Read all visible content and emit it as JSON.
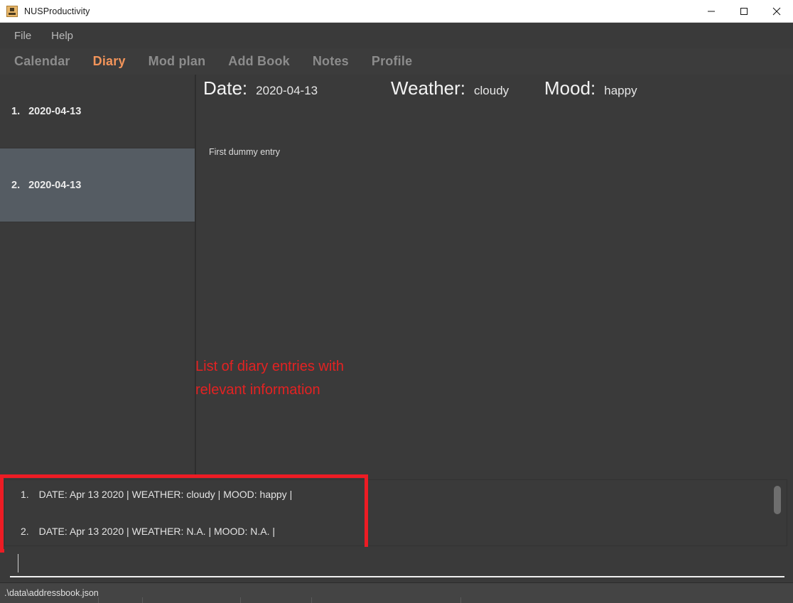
{
  "window": {
    "title": "NUSProductivity",
    "icon": "app-icon",
    "controls": {
      "minimize": "—",
      "maximize": "□",
      "close": "✕"
    }
  },
  "menubar": {
    "items": [
      {
        "label": "File"
      },
      {
        "label": "Help"
      }
    ]
  },
  "tabs": [
    {
      "label": "Calendar",
      "active": false
    },
    {
      "label": "Diary",
      "active": true
    },
    {
      "label": "Mod plan",
      "active": false
    },
    {
      "label": "Add Book",
      "active": false
    },
    {
      "label": "Notes",
      "active": false
    },
    {
      "label": "Profile",
      "active": false
    }
  ],
  "sidebar": {
    "entries": [
      {
        "index": "1.",
        "date": "2020-04-13",
        "selected": false
      },
      {
        "index": "2.",
        "date": "2020-04-13",
        "selected": true
      }
    ]
  },
  "detail": {
    "date_label": "Date:",
    "date_value": "2020-04-13",
    "weather_label": "Weather:",
    "weather_value": "cloudy",
    "mood_label": "Mood:",
    "mood_value": "happy",
    "entry_text": "First dummy entry"
  },
  "annotation": {
    "text": "List of diary entries with\nrelevant information",
    "color": "#e32222"
  },
  "result_box": {
    "lines": [
      {
        "index": "1.",
        "text": "DATE: Apr 13 2020 | WEATHER: cloudy | MOOD: happy |"
      },
      {
        "index": "2.",
        "text": "DATE: Apr 13 2020 | WEATHER: N.A. | MOOD: N.A. |"
      }
    ]
  },
  "command_box": {
    "value": "",
    "placeholder": ""
  },
  "statusbar": {
    "file_path": ".\\data\\addressbook.json"
  },
  "colors": {
    "accent": "#f2945a",
    "background": "#3a3a3a",
    "selected_row": "#555c63",
    "highlight_border": "#ed1c24",
    "status_bar": "#444444"
  }
}
